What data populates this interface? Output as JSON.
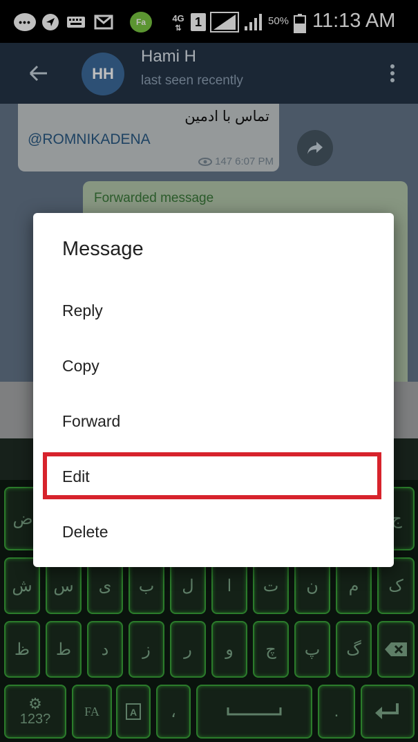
{
  "status_bar": {
    "bubble_text": "•••",
    "app_badge": "Fa",
    "network": "4G",
    "sim": "1",
    "battery_percent": "50%",
    "time": "11:13 AM"
  },
  "header": {
    "avatar_initials": "HH",
    "contact_name": "Hami H",
    "contact_status": "last seen recently"
  },
  "chat": {
    "incoming_message": {
      "text": "تماس با ادمین",
      "mention": "@ROMNIKADENA",
      "views": "147",
      "time": "6:07 PM"
    },
    "outgoing_message": {
      "forwarded_label": "Forwarded message"
    }
  },
  "keyboard": {
    "row1_edge_left": "ض",
    "row1_edge_right": "ج",
    "row2": [
      "ش",
      "س",
      "ی",
      "ب",
      "ل",
      "ا",
      "ت",
      "ن",
      "م",
      "ک"
    ],
    "row3": [
      "ظ",
      "ط",
      "د",
      "ز",
      "ر",
      "و",
      "چ",
      "پ",
      "گ"
    ],
    "bottom": {
      "symbols_key": "123?",
      "lang_key": "FA",
      "comma": "،",
      "period": "."
    }
  },
  "dialog": {
    "title": "Message",
    "items": [
      {
        "label": "Reply"
      },
      {
        "label": "Copy"
      },
      {
        "label": "Forward"
      },
      {
        "label": "Edit"
      },
      {
        "label": "Delete"
      }
    ],
    "highlight_color": "#d7232c"
  }
}
